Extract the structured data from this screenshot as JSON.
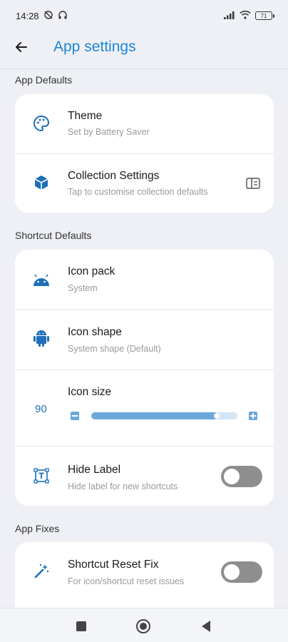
{
  "status_bar": {
    "time": "14:28",
    "battery": "71"
  },
  "app_bar": {
    "title": "App settings"
  },
  "sections": {
    "app_defaults": "App Defaults",
    "shortcut_defaults": "Shortcut Defaults",
    "app_fixes": "App Fixes"
  },
  "app_defaults": {
    "theme": {
      "title": "Theme",
      "subtitle": "Set by Battery Saver",
      "icon": "palette-icon"
    },
    "collection": {
      "title": "Collection Settings",
      "subtitle": "Tap to customise collection defaults",
      "icon": "cube-icon",
      "trailing_icon": "open-panel-icon"
    }
  },
  "shortcut_defaults": {
    "icon_pack": {
      "title": "Icon pack",
      "subtitle": "System",
      "icon": "android-head-icon"
    },
    "icon_shape": {
      "title": "Icon shape",
      "subtitle": "System shape (Default)",
      "icon": "android-robot-icon"
    },
    "icon_size": {
      "title": "Icon size",
      "value": "90",
      "slider_fraction": 0.87
    },
    "hide_label": {
      "title": "Hide Label",
      "subtitle": "Hide label for new shortcuts",
      "icon": "label-frame-icon",
      "enabled": false
    }
  },
  "app_fixes": {
    "reset_fix": {
      "title": "Shortcut Reset Fix",
      "subtitle": "For icon/shortcut reset issues",
      "icon": "magic-wand-icon",
      "enabled": false
    }
  },
  "colors": {
    "accent": "#1e86d6",
    "icon_blue": "#1e6fb8",
    "toggle_off": "#8e8e8e"
  },
  "nav_bar": {
    "icons": [
      "recents-icon",
      "home-icon",
      "back-triangle-icon"
    ]
  }
}
